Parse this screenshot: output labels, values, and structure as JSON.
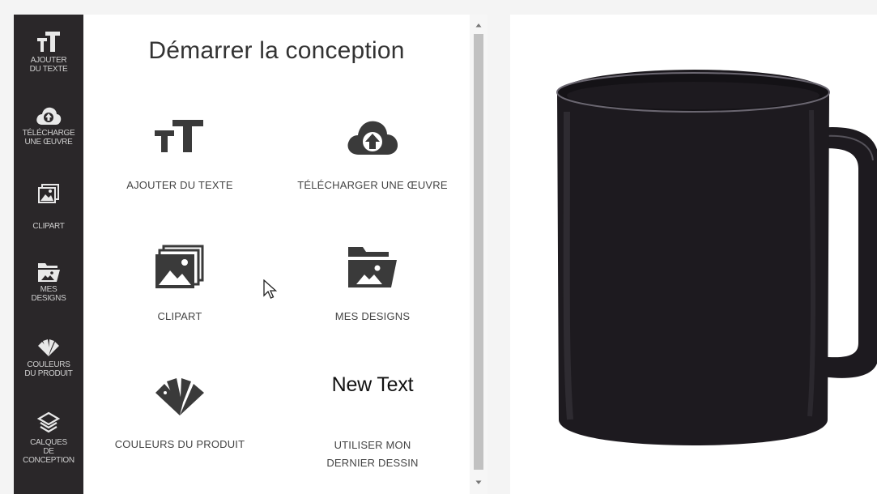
{
  "rail": {
    "items": [
      {
        "label": "AJOUTER\nDU TEXTE",
        "icon": "text-size-icon"
      },
      {
        "label": "TÉLÉCHARGE\nUNE ŒUVRE",
        "icon": "cloud-upload-icon"
      },
      {
        "label": "CLIPART",
        "icon": "images-icon"
      },
      {
        "label": "MES\nDESIGNS",
        "icon": "folder-image-icon"
      },
      {
        "label": "COULEURS\nDU PRODUIT",
        "icon": "color-swatch-icon"
      },
      {
        "label": "CALQUES\nDE\nCONCEPTION",
        "icon": "layers-icon"
      }
    ]
  },
  "panel": {
    "title": "Démarrer la conception",
    "tiles": [
      {
        "label": "AJOUTER DU TEXTE",
        "icon": "text-size-icon"
      },
      {
        "label": "TÉLÉCHARGER UNE ŒUVRE",
        "icon": "cloud-upload-icon"
      },
      {
        "label": "CLIPART",
        "icon": "images-icon"
      },
      {
        "label": "MES DESIGNS",
        "icon": "folder-image-icon"
      },
      {
        "label": "COULEURS DU PRODUIT",
        "icon": "color-swatch-icon"
      },
      {
        "label": "UTILISER MON DERNIER DESSIN",
        "preview_text": "New Text"
      }
    ]
  },
  "product": {
    "name_icon": "mug-image",
    "color": "#1d1a1f"
  },
  "colors": {
    "rail_bg": "#2a2729",
    "accent_icon": "#3a3a3a"
  }
}
